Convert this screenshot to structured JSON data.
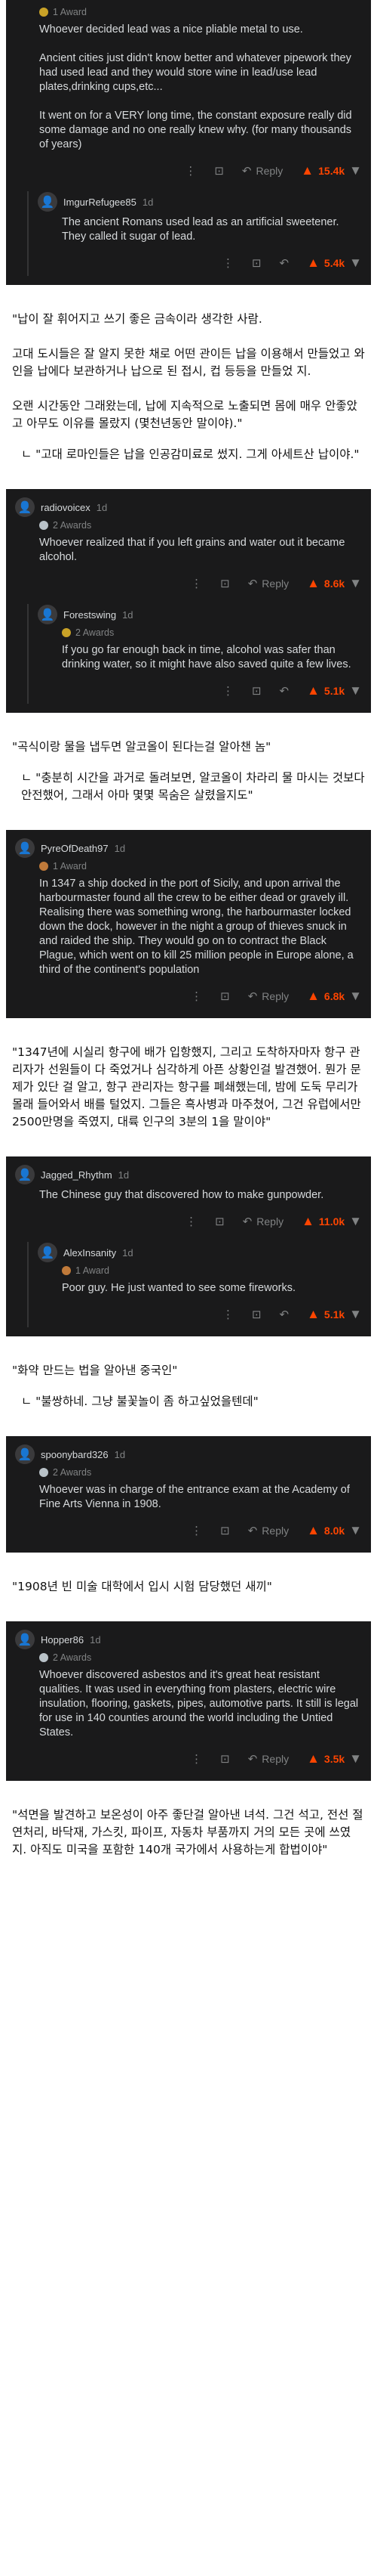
{
  "c1": {
    "awards": "1 Award",
    "body": "Whoever decided lead was a nice pliable metal to use.\n\nAncient cities just didn't know better and whatever pipework they had used lead and they would store wine in lead/use lead plates,drinking cups,etc...\n\nIt went on for a VERY long time, the constant exposure really did some damage and no one really knew why. (for many thousands of years)",
    "reply_label": "Reply",
    "votes": "15.4k",
    "reply": {
      "user": "ImgurRefugee85",
      "age": "1d",
      "body": "The ancient Romans used lead as an artificial sweetener. They called it sugar of lead.",
      "votes": "5.4k"
    }
  },
  "k1": {
    "main": "\"납이 잘 휘어지고 쓰기 좋은 금속이라 생각한 사람.\n\n 고대 도시들은 잘 알지 못한 채로 어떤 관이든 납을 이용해서 만들었고 와인을 납에다 보관하거나 납으로 된 접시, 컵 등등을 만들었 지.\n\n 오랜 시간동안 그래왔는데, 납에 지속적으로 노출되면 몸에 매우 안좋았고 아무도 이유를 몰랐지 (몇천년동안 말이야).\"",
    "reply": "ㄴ \"고대 로마인들은 납을 인공감미료로 썼지. 그게 아세트산 납이야.\""
  },
  "c2": {
    "user": "radiovoicex",
    "age": "1d",
    "awards": "2 Awards",
    "body": "Whoever realized that if you left grains and water out it became alcohol.",
    "reply_label": "Reply",
    "votes": "8.6k",
    "reply": {
      "user": "Forestswing",
      "age": "1d",
      "awards": "2 Awards",
      "body": "If you go far enough back in time, alcohol was safer than drinking water, so it might have also saved quite a few lives.",
      "votes": "5.1k"
    }
  },
  "k2": {
    "main": "\"곡식이랑 물을 냅두면 알코올이 된다는걸 알아챈 놈\"",
    "reply": "ㄴ \"충분히 시간을 과거로 돌려보면, 알코올이 차라리 물 마시는 것보다 안전했어, 그래서 아마 몇몇 목숨은 살렸을지도\""
  },
  "c3": {
    "user": "PyreOfDeath97",
    "age": "1d",
    "awards": "1 Award",
    "body": "In 1347 a ship docked in the port of Sicily, and upon arrival the harbourmaster found all the crew to be either dead or gravely ill. Realising there was something wrong, the harbourmaster locked down the dock, however in the night a group of thieves snuck in and raided the ship. They would go on to contract the Black Plague, which went on to kill 25 million people in Europe alone, a third of the continent's population",
    "reply_label": "Reply",
    "votes": "6.8k"
  },
  "k3": {
    "main": "\"1347년에 시실리 항구에 배가 입항했지, 그리고 도착하자마자 항구 관리자가 선원들이 다 죽었거나 심각하게 아픈 상황인걸 발견했어. 뭔가 문제가 있단 걸 알고, 항구 관리자는 항구를 폐쇄했는데, 밤에 도둑 무리가 몰래 들어와서 배를 털었지. 그들은 흑사병과 마주쳤어, 그건 유럽에서만 2500만명을 죽였지, 대륙 인구의 3분의 1을 말이야\""
  },
  "c4": {
    "user": "Jagged_Rhythm",
    "age": "1d",
    "body": "The Chinese guy that discovered how to make gunpowder.",
    "reply_label": "Reply",
    "votes": "11.0k",
    "reply": {
      "user": "AlexInsanity",
      "age": "1d",
      "awards": "1 Award",
      "body": "Poor guy. He just wanted to see some fireworks.",
      "votes": "5.1k"
    }
  },
  "k4": {
    "main": "\"화약 만드는 법을 알아낸 중국인\"",
    "reply": "ㄴ \"불쌍하네. 그냥 불꽃놀이 좀 하고싶었을텐데\""
  },
  "c5": {
    "user": "spoonybard326",
    "age": "1d",
    "awards": "2 Awards",
    "body": "Whoever was in charge of the entrance exam at the Academy of Fine Arts Vienna in 1908.",
    "reply_label": "Reply",
    "votes": "8.0k"
  },
  "k5": {
    "main": "\"1908년 빈 미술 대학에서 입시 시험 담당했던 새끼\""
  },
  "c6": {
    "user": "Hopper86",
    "age": "1d",
    "awards": "2 Awards",
    "body": "Whoever discovered asbestos and it's great heat resistant qualities. It was used in everything from plasters, electric wire insulation, flooring, gaskets, pipes, automotive parts. It still is legal for use in 140 counties around the world including the Untied States.",
    "reply_label": "Reply",
    "votes": "3.5k"
  },
  "k6": {
    "main": "\"석면을 발견하고 보온성이 아주 좋단걸 알아낸 녀석. 그건 석고, 전선 절연처리, 바닥재, 가스킷, 파이프, 자동차 부품까지 거의 모든 곳에 쓰였지. 아직도 미국을 포함한 140개 국가에서 사용하는게 합법이야\""
  }
}
